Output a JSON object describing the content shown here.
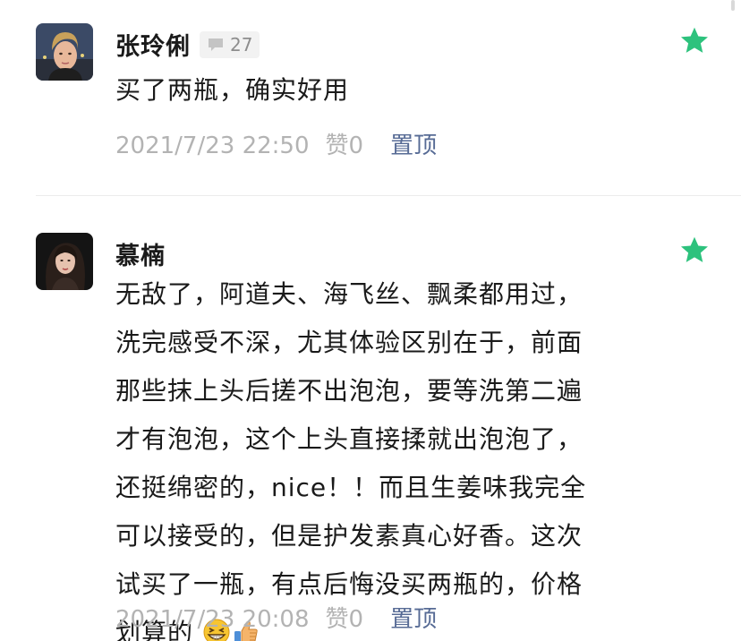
{
  "comments": [
    {
      "author": "张玲俐",
      "reply_count": "27",
      "text": "买了两瓶，确实好用",
      "timestamp": "2021/7/23 22:50",
      "likes_label": "赞0",
      "pin_label": "置顶",
      "starred": true
    },
    {
      "author": "慕楠",
      "text_lines": [
        "无敌了，阿道夫、海飞丝、飘柔都用过，",
        "洗完感受不深，尤其体验区别在于，前面",
        "那些抹上头后搓不出泡泡，要等洗第二遍",
        "才有泡泡，这个上头直接揉就出泡泡了，",
        "还挺绵密的，nice！！而且生姜味我完全",
        "可以接受的，但是护发素真心好香。这次",
        "试买了一瓶，有点后悔没买两瓶的，价格",
        "划算的"
      ],
      "emoji": [
        "grinning-squint-emoji",
        "thumbs-up-emoji"
      ],
      "timestamp": "2021/7/23 20:08",
      "likes_label": "赞0",
      "pin_label": "置顶",
      "starred": true
    }
  ],
  "colors": {
    "star": "#2dc27d",
    "pin_link": "#576b95",
    "meta_text": "#b3b3b3",
    "badge_bg": "#f2f2f2"
  }
}
